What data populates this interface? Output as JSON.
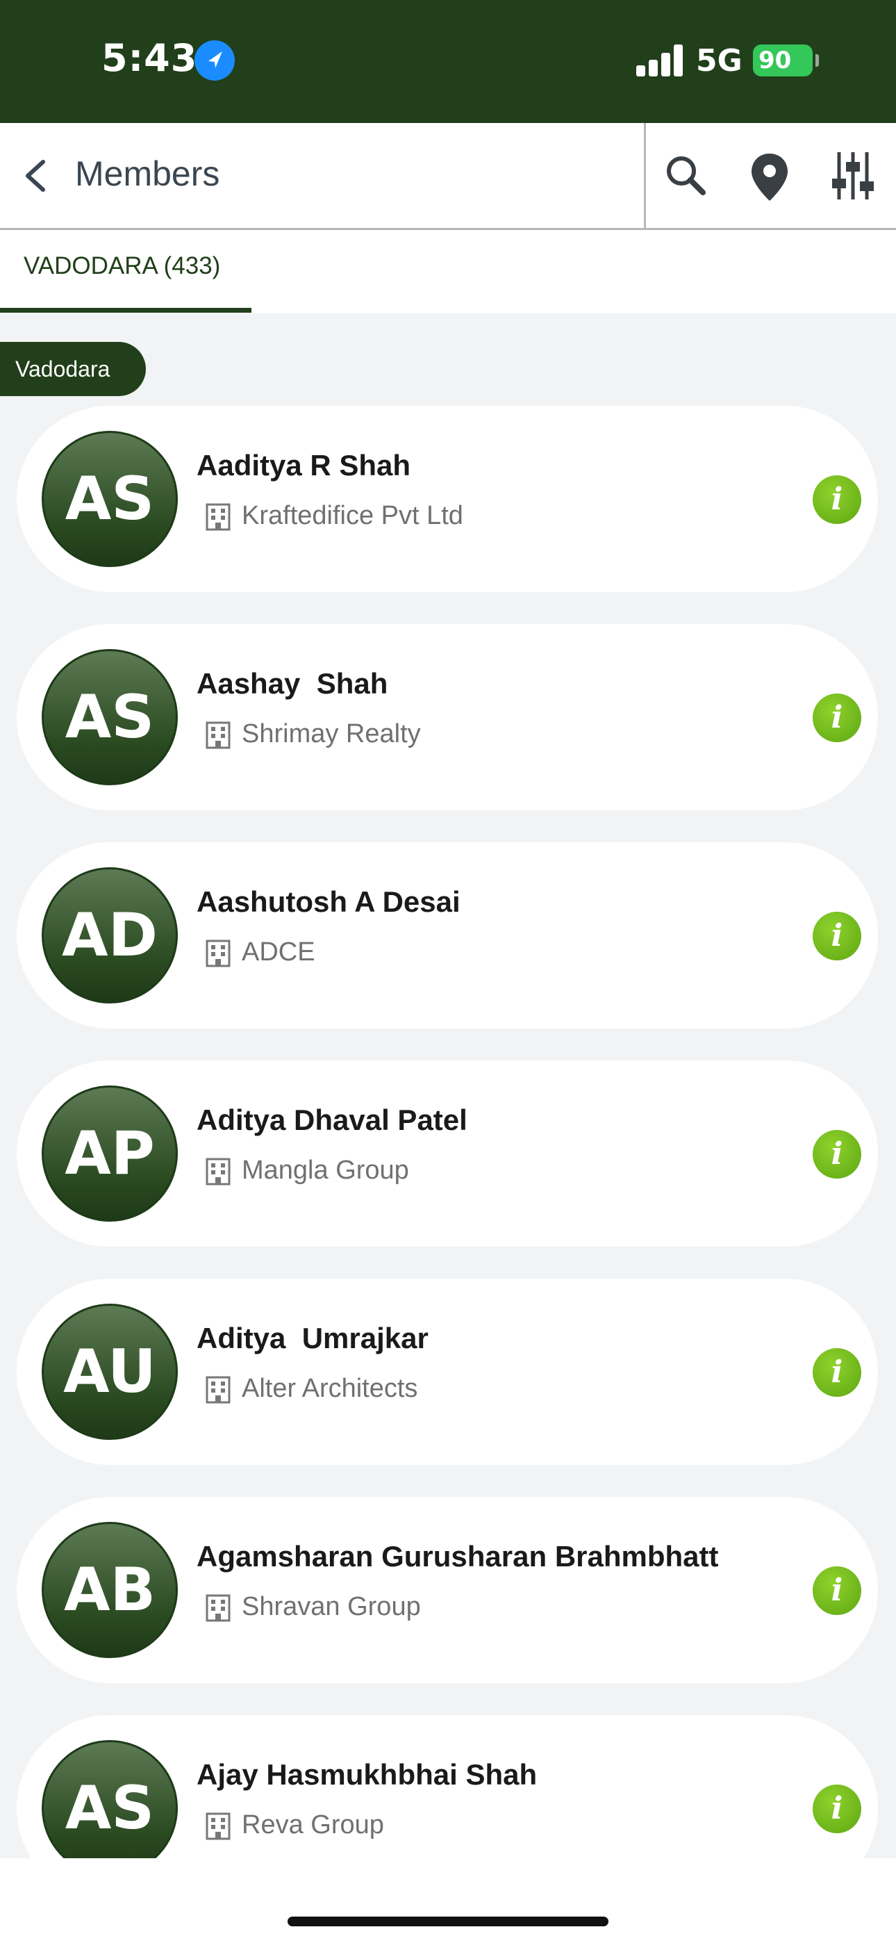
{
  "status_bar": {
    "time": "5:43",
    "network": "5G",
    "battery": "90"
  },
  "header": {
    "title": "Members",
    "icons": [
      "back-chevron-icon",
      "search-icon",
      "map-pin-icon",
      "filter-sliders-icon"
    ]
  },
  "tabs": [
    {
      "label": "VADODARA (433)",
      "active": true
    }
  ],
  "section": {
    "label": "Vadodara"
  },
  "members": [
    {
      "initials": "AS",
      "name": "Aaditya R Shah",
      "company": "Kraftedifice Pvt Ltd"
    },
    {
      "initials": "AS",
      "name": "Aashay  Shah",
      "company": "Shrimay Realty"
    },
    {
      "initials": "AD",
      "name": "Aashutosh A Desai",
      "company": "ADCE"
    },
    {
      "initials": "AP",
      "name": "Aditya Dhaval Patel",
      "company": "Mangla Group"
    },
    {
      "initials": "AU",
      "name": "Aditya  Umrajkar",
      "company": "Alter Architects"
    },
    {
      "initials": "AB",
      "name": "Agamsharan Gurusharan Brahmbhatt",
      "company": "Shravan Group"
    },
    {
      "initials": "AS",
      "name": "Ajay Hasmukhbhai Shah",
      "company": "Reva Group"
    }
  ],
  "info_label": "i",
  "colors": {
    "brand": "#213f1a",
    "info": "#6fbf1a",
    "background": "#f2f3f5"
  }
}
